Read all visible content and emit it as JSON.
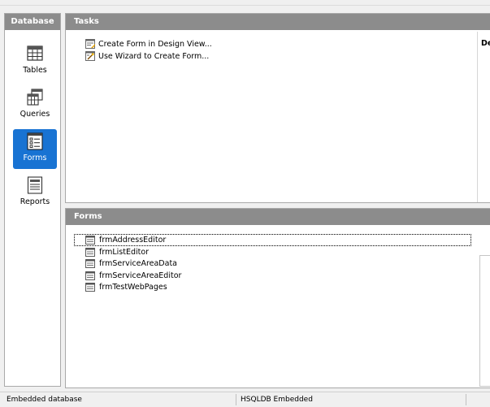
{
  "sidebar": {
    "header": "Database",
    "items": [
      {
        "label": "Tables",
        "icon": "table-icon"
      },
      {
        "label": "Queries",
        "icon": "query-icon"
      },
      {
        "label": "Forms",
        "icon": "form-icon"
      },
      {
        "label": "Reports",
        "icon": "report-icon"
      }
    ],
    "active": "Forms"
  },
  "tasks": {
    "header": "Tasks",
    "items": [
      {
        "label": "Create Form in Design View..."
      },
      {
        "label": "Use Wizard to Create Form..."
      }
    ],
    "description_label": "De"
  },
  "forms": {
    "header": "Forms",
    "items": [
      {
        "label": "frmAddressEditor"
      },
      {
        "label": "frmListEditor"
      },
      {
        "label": "frmServiceAreaData"
      },
      {
        "label": "frmServiceAreaEditor"
      },
      {
        "label": "frmTestWebPages"
      }
    ],
    "selected": "frmAddressEditor"
  },
  "statusbar": {
    "left": "Embedded database",
    "right": "HSQLDB Embedded"
  },
  "colors": {
    "header_bg": "#8c8c8c",
    "active_bg": "#1873d3",
    "panel_border": "#a9a9a9"
  }
}
